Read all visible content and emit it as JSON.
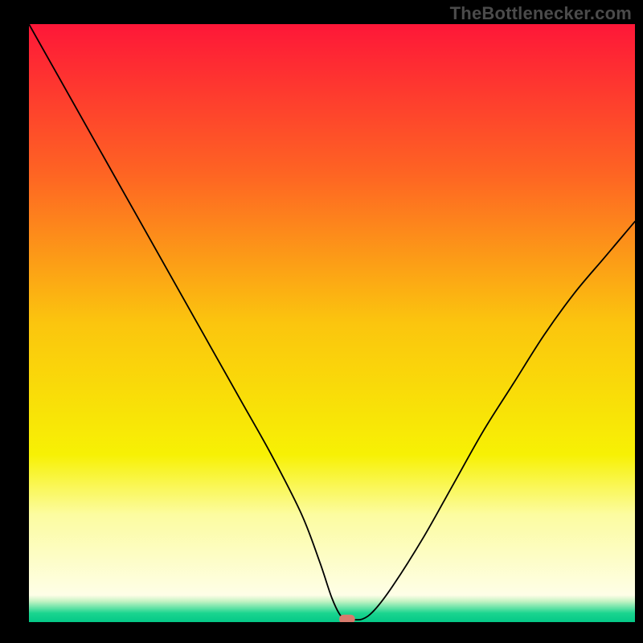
{
  "watermark": "TheBottlenecker.com",
  "chart_data": {
    "type": "line",
    "title": "",
    "xlabel": "",
    "ylabel": "",
    "xlim": [
      0,
      100
    ],
    "ylim": [
      0,
      100
    ],
    "grid": false,
    "legend": false,
    "background": {
      "type": "vertical-gradient",
      "stops": [
        {
          "pos": 0.0,
          "color": "#fe1738"
        },
        {
          "pos": 0.25,
          "color": "#fe6423"
        },
        {
          "pos": 0.5,
          "color": "#fbc50e"
        },
        {
          "pos": 0.72,
          "color": "#f7f104"
        },
        {
          "pos": 0.82,
          "color": "#fcfca0"
        },
        {
          "pos": 0.955,
          "color": "#fefee7"
        },
        {
          "pos": 0.965,
          "color": "#c5f3c4"
        },
        {
          "pos": 0.985,
          "color": "#1ad58f"
        },
        {
          "pos": 1.0,
          "color": "#04c887"
        }
      ]
    },
    "series": [
      {
        "name": "bottleneck-curve",
        "x": [
          0,
          5,
          10,
          15,
          20,
          25,
          30,
          35,
          40,
          45,
          48,
          50,
          51.5,
          53,
          55,
          57,
          60,
          65,
          70,
          75,
          80,
          85,
          90,
          95,
          100
        ],
        "y": [
          100,
          91,
          82,
          73,
          64,
          55,
          46,
          37,
          28,
          18,
          10,
          4,
          1,
          0.5,
          0.5,
          2,
          6,
          14,
          23,
          32,
          40,
          48,
          55,
          61,
          67
        ]
      }
    ],
    "marker": {
      "x": 52.5,
      "y": 0.5,
      "color": "#d87b6d"
    }
  }
}
